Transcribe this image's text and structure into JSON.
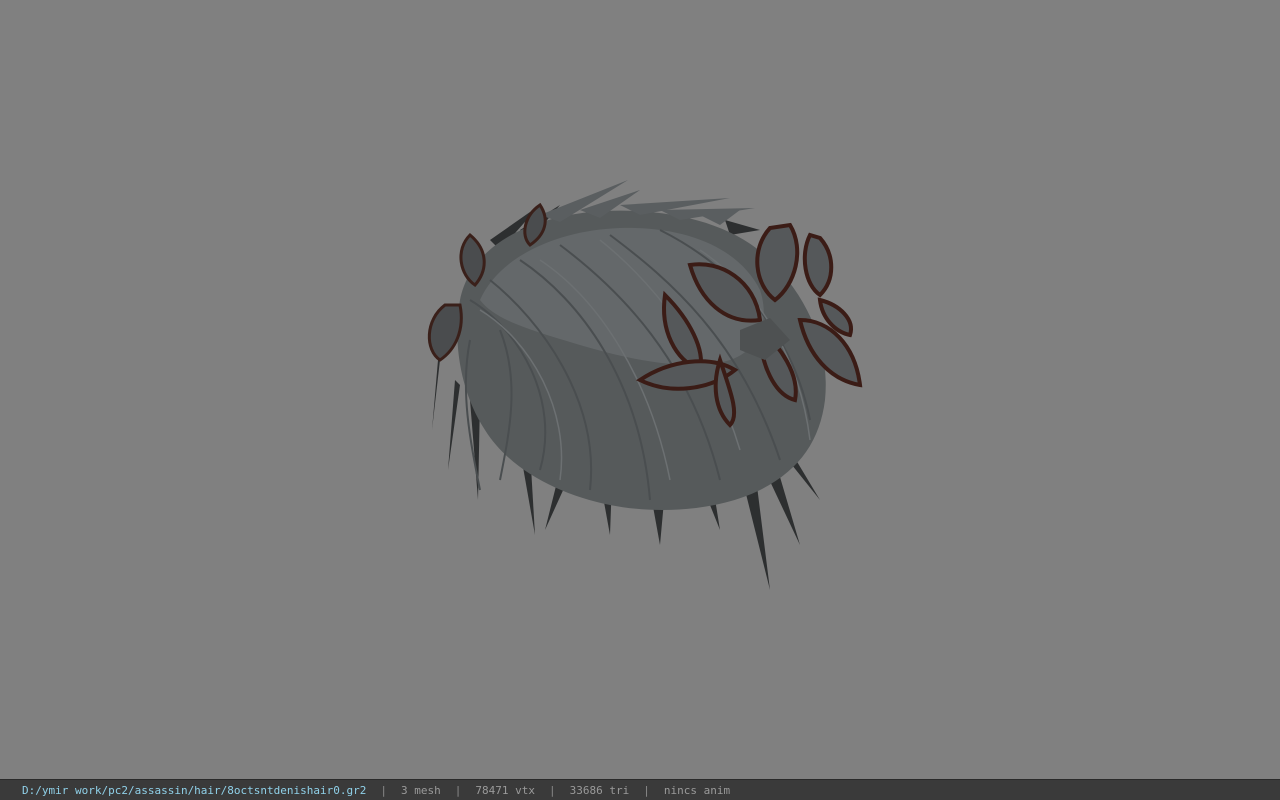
{
  "viewer": {
    "background_color": "#808080",
    "model": "hair-mesh-icon"
  },
  "status": {
    "file_path": "D:/ymir work/pc2/assassin/hair/8octsntdenishair0.gr2",
    "separator": "|",
    "mesh": "3 mesh",
    "vtx": "78471 vtx",
    "tri": "33686 tri",
    "anim": "nincs anim",
    "colors": {
      "bar": "#3a3a3a",
      "path": "#8fd0e8",
      "text": "#9a9a9a"
    }
  }
}
